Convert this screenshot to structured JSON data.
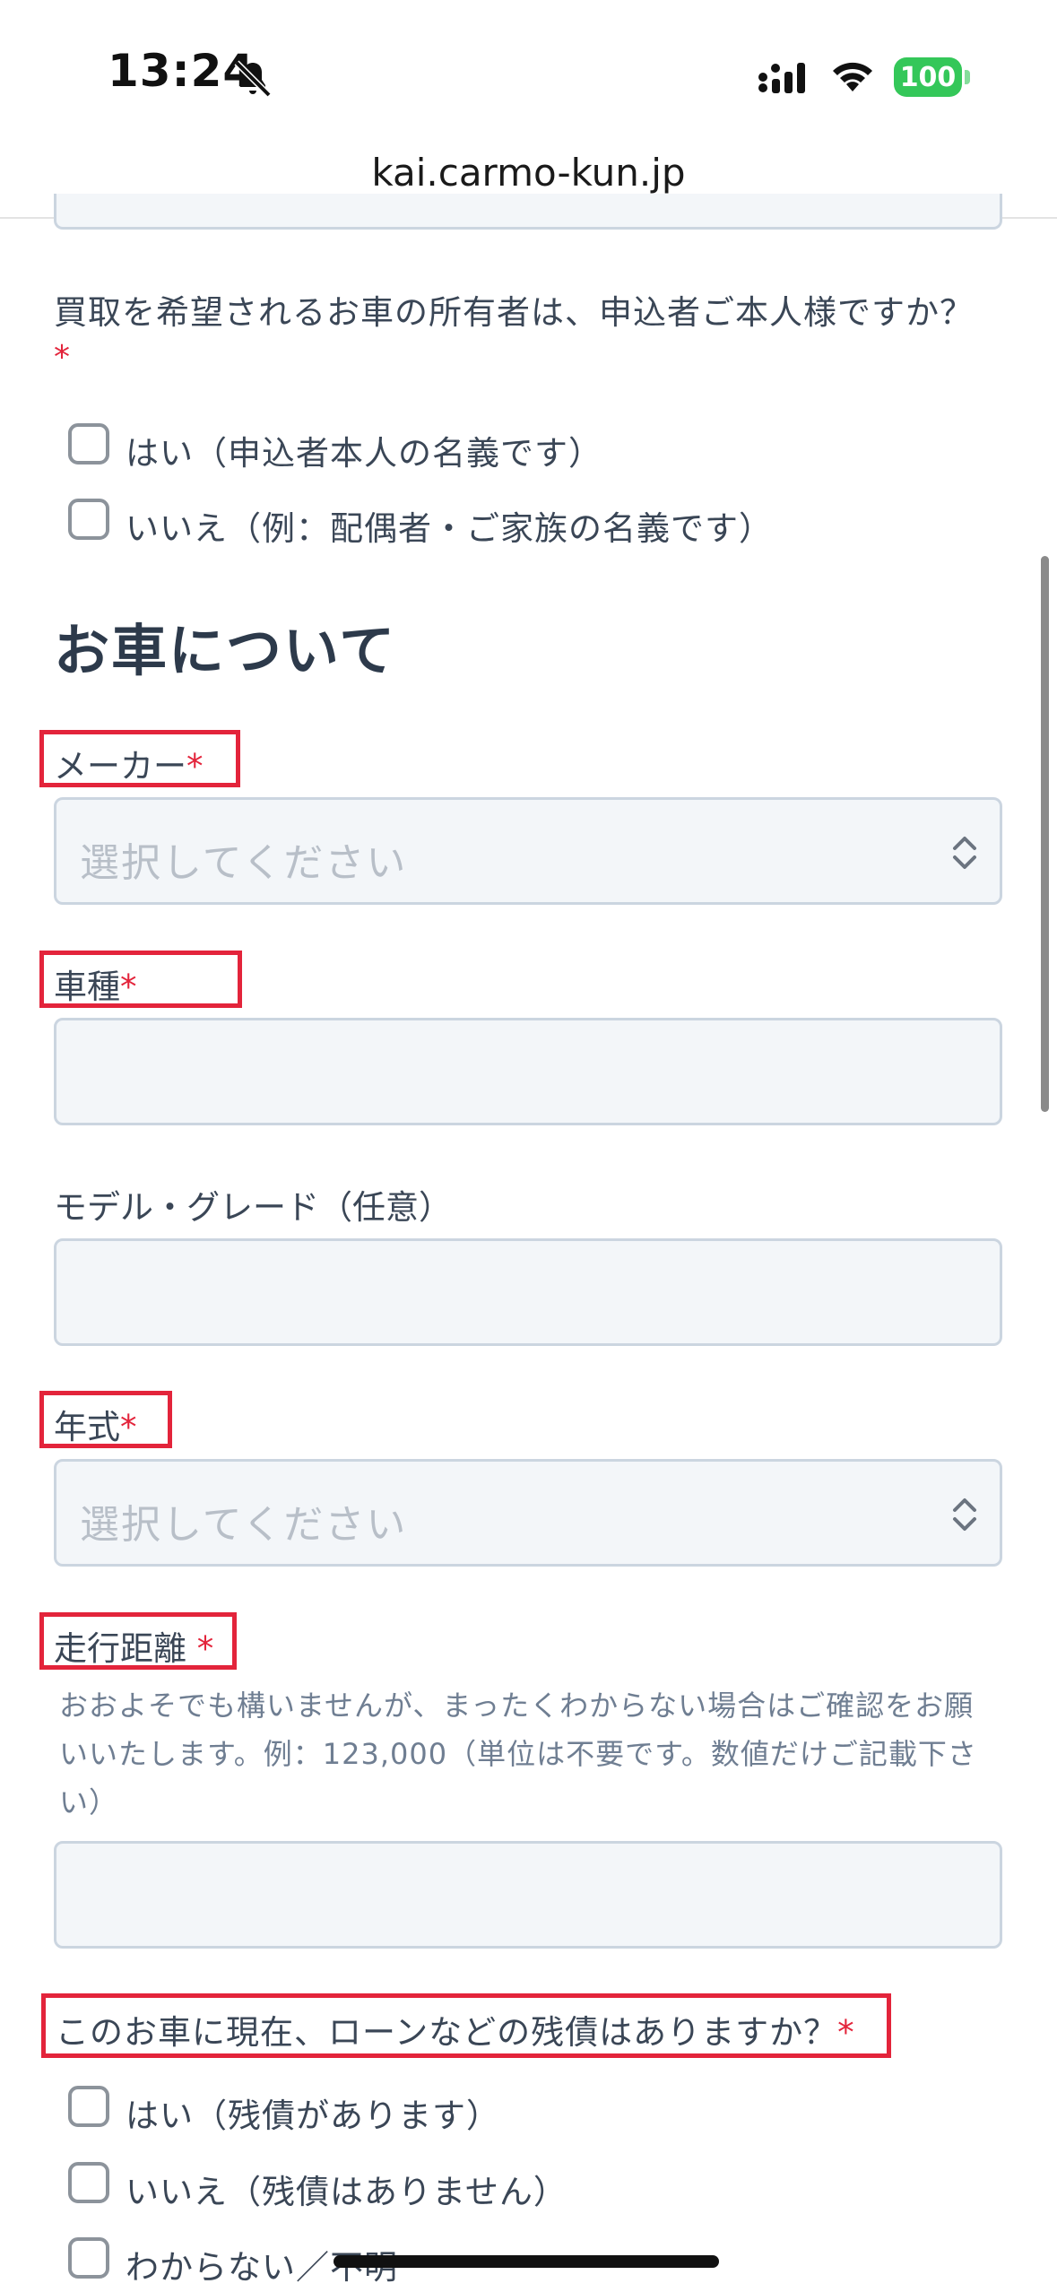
{
  "status_bar": {
    "time": "13:24",
    "battery": "100",
    "icons": [
      "bell-slash-icon",
      "cellular-signal-icon",
      "wifi-icon",
      "battery-icon"
    ]
  },
  "browser": {
    "url": "kai.carmo-kun.jp"
  },
  "owner_question": {
    "text": "買取を希望されるお車の所有者は、申込者ご本人様ですか？",
    "required_mark": "*",
    "options": [
      "はい（申込者本人の名義です）",
      "いいえ（例：配偶者・ご家族の名義です）"
    ]
  },
  "section": {
    "title": "お車について"
  },
  "fields": {
    "maker": {
      "label": "メーカー",
      "required_mark": "*",
      "placeholder": "選択してください"
    },
    "model": {
      "label": "車種",
      "required_mark": "*",
      "value": ""
    },
    "grade": {
      "label": "モデル・グレード（任意）",
      "value": ""
    },
    "year": {
      "label": "年式",
      "required_mark": "*",
      "placeholder": "選択してください"
    },
    "mileage": {
      "label": "走行距離",
      "required_mark": "*",
      "hint_line1": "おおよそでも構いませんが、まったくわからない場合はご確認をお願",
      "hint_line2": "いいたします。例：123,000（単位は不要です。数値だけご記載下さ",
      "hint_line3": "い）",
      "value": ""
    }
  },
  "loan_question": {
    "text": "このお車に現在、ローンなどの残債はありますか？",
    "required_mark": "*",
    "options": [
      "はい（残債があります）",
      "いいえ（残債はありません）",
      "わからない／不明"
    ]
  },
  "colors": {
    "required": "#e3243b",
    "highlight_box": "#e3243b",
    "field_bg": "#f3f6f9",
    "field_border": "#cbd5e0",
    "text": "#3a4656",
    "battery": "#34c759"
  }
}
